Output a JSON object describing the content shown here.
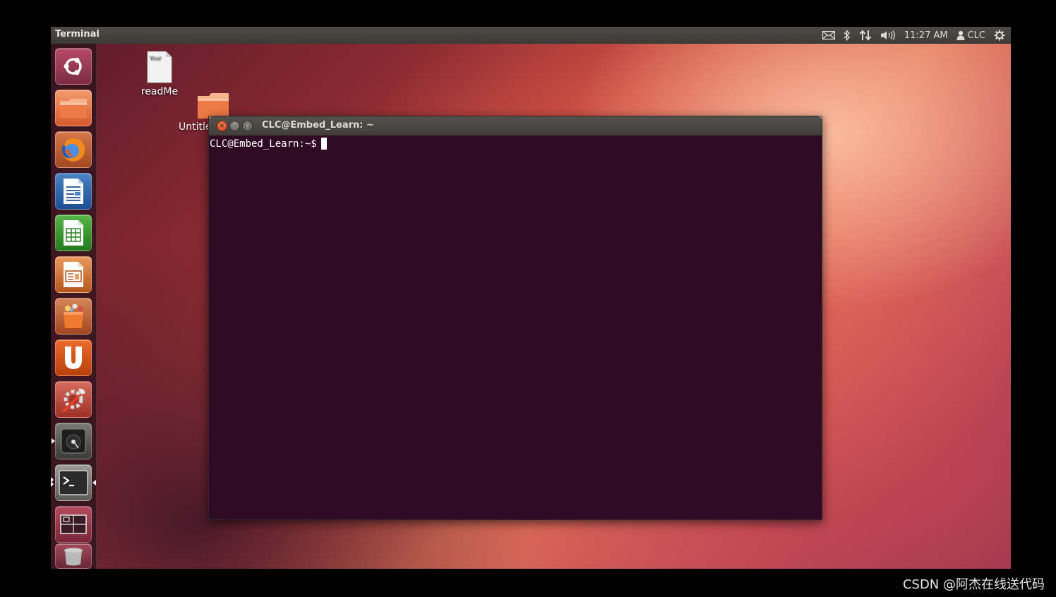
{
  "top_panel": {
    "app_title": "Terminal",
    "clock": "11:27 AM",
    "user": "CLC",
    "icons": [
      "mail-icon",
      "bluetooth-icon",
      "network-icon",
      "volume-icon",
      "user-icon",
      "gear-icon"
    ]
  },
  "launcher": {
    "items": [
      {
        "name": "dash-home",
        "icon": "ubuntu-logo-icon"
      },
      {
        "name": "files",
        "icon": "folder-icon"
      },
      {
        "name": "firefox",
        "icon": "firefox-icon"
      },
      {
        "name": "writer",
        "icon": "writer-document-icon"
      },
      {
        "name": "calc",
        "icon": "spreadsheet-icon"
      },
      {
        "name": "impress",
        "icon": "presentation-icon"
      },
      {
        "name": "software-center",
        "icon": "shopping-bag-icon"
      },
      {
        "name": "ubuntu-one",
        "icon": "ubuntu-one-icon"
      },
      {
        "name": "system-settings",
        "icon": "settings-tools-icon"
      },
      {
        "name": "disk-manager",
        "icon": "hard-disk-icon"
      },
      {
        "name": "terminal",
        "icon": "terminal-icon"
      },
      {
        "name": "workspaces",
        "icon": "workspace-switcher-icon"
      },
      {
        "name": "trash",
        "icon": "trash-icon"
      }
    ]
  },
  "desktop": {
    "icons": [
      {
        "label": "readMe",
        "thumb_text": "Your",
        "icon": "text-file-icon"
      },
      {
        "label": "Untitle",
        "icon": "folder-icon"
      }
    ]
  },
  "terminal": {
    "title": "CLC@Embed_Learn: ~",
    "prompt": "CLC@Embed_Learn:~$",
    "close_glyph": "×",
    "minimize_glyph": "–",
    "maximize_glyph": "□"
  },
  "watermark": "CSDN @阿杰在线送代码",
  "colors": {
    "terminal_bg": "#300a24",
    "panel_bg": "#3c3b37",
    "accent_orange": "#e95420"
  }
}
